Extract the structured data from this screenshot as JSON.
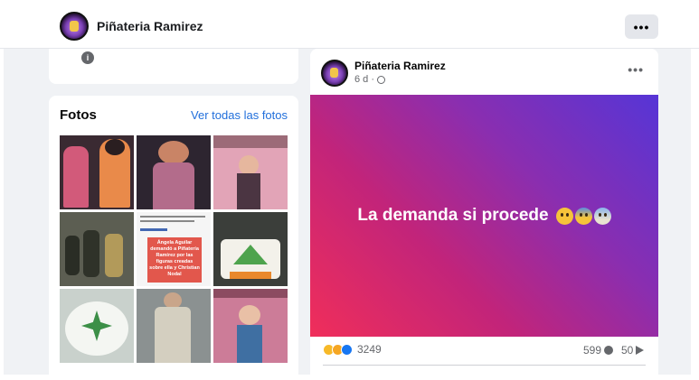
{
  "header": {
    "page_name": "Piñateria Ramirez",
    "more_label": "•••",
    "avatar_icon": "page-avatar-icon"
  },
  "intro": {
    "info_icon_glyph": "i"
  },
  "photos": {
    "title": "Fotos",
    "see_all_label": "Ver todas las fotos",
    "tiles": [
      {
        "subject": "pinatas-pink-outfit",
        "colors": [
          "#3a2a32",
          "#d25a7a"
        ]
      },
      {
        "subject": "pinata-dark-dress",
        "colors": [
          "#2d2530",
          "#b36c8b"
        ]
      },
      {
        "subject": "pinata-pink-wall",
        "colors": [
          "#e2a4b7",
          "#4b3542"
        ]
      },
      {
        "subject": "crowd-figures",
        "colors": [
          "#5c5e52",
          "#2a2d25"
        ]
      },
      {
        "subject": "news-article",
        "colors": [
          "#f5f5f5",
          "#e2574c"
        ]
      },
      {
        "subject": "decorated-cake",
        "colors": [
          "#3b3e3a",
          "#4ea34d"
        ]
      },
      {
        "subject": "leaf-cake",
        "colors": [
          "#c9d1cc",
          "#3c8f47"
        ]
      },
      {
        "subject": "man-denim-jacket",
        "colors": [
          "#8b9191",
          "#d4cfc0"
        ]
      },
      {
        "subject": "pinata-standing",
        "colors": [
          "#cc7c98",
          "#3f6fa2"
        ]
      }
    ],
    "news_text": "Ángela Aguilar demandó a Piñatería Ramírez por las figuras creadas sobre ella y Christian Nodal"
  },
  "post": {
    "author": "Piñateria Ramirez",
    "time": "6 d ·",
    "more_label": "•••",
    "banner_text": "La demanda si procede",
    "banner_colors": [
      "#f02e5a",
      "#5635d6"
    ],
    "emojis": [
      "flushed-face-icon",
      "anxious-sweat-face-icon",
      "screaming-face-icon"
    ],
    "reaction_count": "3249",
    "comment_count": "599",
    "share_count": "50"
  }
}
